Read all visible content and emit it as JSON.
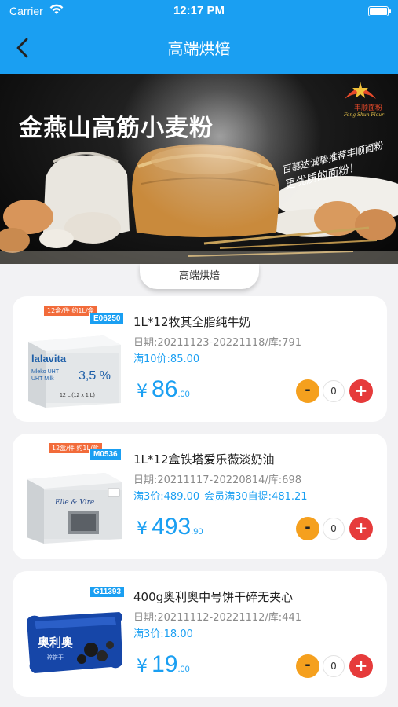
{
  "status_bar": {
    "carrier": "Carrier",
    "time": "12:17 PM"
  },
  "nav": {
    "title": "高端烘焙"
  },
  "banner": {
    "headline": "金燕山高筋小麦粉",
    "slogan_line1": "百慕达诚挚推荐丰顺面粉",
    "slogan_line2": "更优质的面粉！",
    "logo_text": "丰顺面粉",
    "logo_en": "Feng Shun Flour"
  },
  "tab": {
    "label": "高端烘焙"
  },
  "colors": {
    "primary": "#1a9ff2",
    "minus": "#f5a01e",
    "plus": "#e63b3b",
    "tag_red": "#f26b3a"
  },
  "products": [
    {
      "tag_promo": "12盒/件  约1L/盒",
      "code": "E06250",
      "box_brand": "lalavita",
      "box_line1": "Mleko UHT",
      "box_line2": "UHT Milk",
      "box_fat": "3,5 %",
      "box_volume": "12 L (12 x 1 L)",
      "name": "1L*12牧其全脂纯牛奶",
      "meta": "日期:20211123-20221118/库:791",
      "promo": "满10价:85.00",
      "member_promo": "",
      "currency": "¥",
      "price_int": "86",
      "price_dec": ".00",
      "quantity": "0"
    },
    {
      "tag_promo": "12盒/件  约1L/盒",
      "code": "M0536",
      "box_brand": "Elle & Vire",
      "name": "1L*12盒铁塔爱乐薇淡奶油",
      "meta": "日期:20211117-20220814/库:698",
      "promo": "满3价:489.00",
      "member_promo": "会员满30自提:481.21",
      "currency": "¥",
      "price_int": "493",
      "price_dec": ".90",
      "quantity": "0"
    },
    {
      "code": "G11393",
      "box_brand": "奥利奥",
      "box_sub": "碎饼干",
      "name": "400g奥利奥中号饼干碎无夹心",
      "meta": "日期:20211112-20221112/库:441",
      "promo": "满3价:18.00",
      "member_promo": "",
      "currency": "¥",
      "price_int": "19",
      "price_dec": ".00",
      "quantity": "0"
    }
  ],
  "icons": {
    "back": "chevron-left-icon",
    "wifi": "wifi-icon",
    "battery": "battery-icon",
    "minus": "minus-icon",
    "plus": "plus-icon"
  }
}
